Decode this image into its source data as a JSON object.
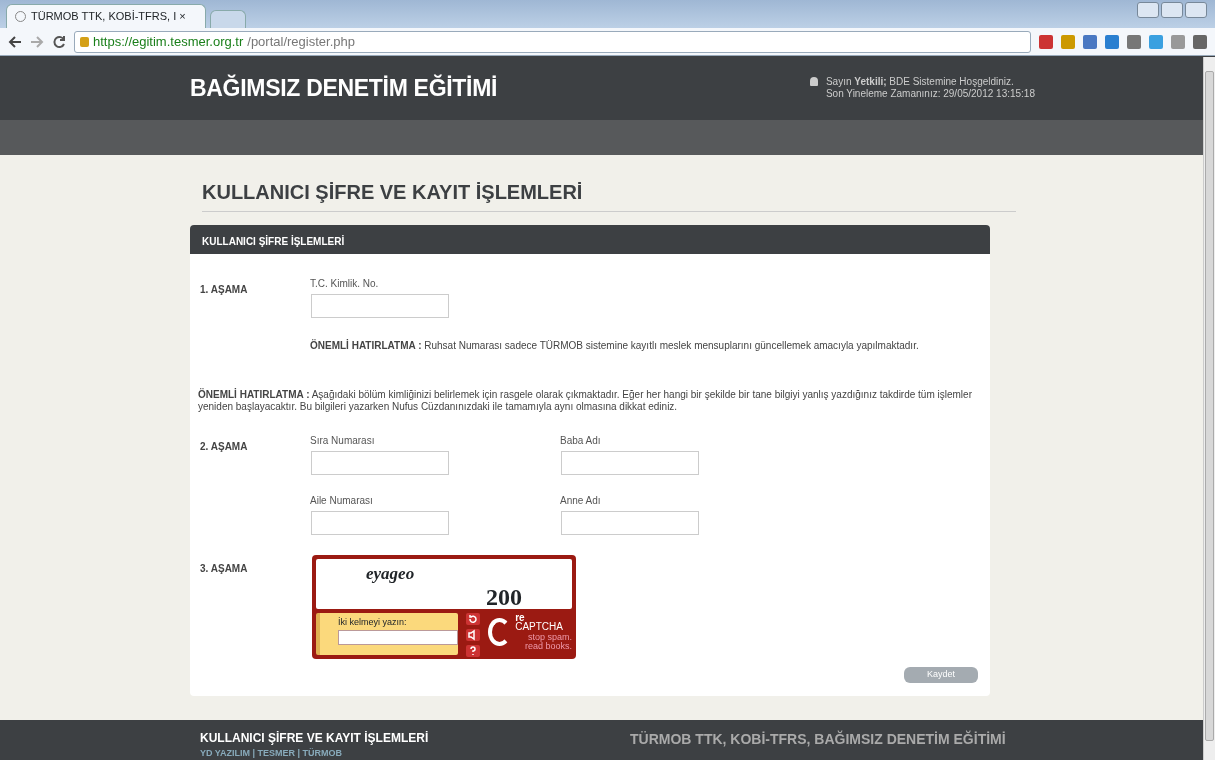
{
  "browser": {
    "tab_title": "TÜRMOB TTK, KOBİ-TFRS, I ×",
    "url_host": "https://egitim.tesmer.org.tr",
    "url_path": "/portal/register.php"
  },
  "header": {
    "title": "BAĞIMSIZ DENETİM EĞİTİMİ",
    "greeting": "Sayın **Yetkili;** BDE Sistemine Hoşgeldiniz.",
    "last_refresh": "Son Yineleme Zamanınız: 29/05/2012 13:15:18"
  },
  "page_title": "KULLANICI ŞİFRE VE KAYIT İŞLEMLERİ",
  "panel": {
    "title": "KULLANICI ŞİFRE İŞLEMLERİ",
    "step1": {
      "label": "1. AŞAMA",
      "fields": [
        {
          "label": "T.C. Kimlik. No."
        }
      ],
      "note": "**ÖNEMLİ HATIRLATMA :** Ruhsat Numarası sadece TÜRMOB sistemine kayıtlı meslek mensuplarını güncellemek amacıyla yapılmaktadır."
    },
    "note": "**ÖNEMLİ HATIRLATMA :** Aşağıdaki bölüm kimliğinizi belirlemek için rasgele olarak çıkmaktadır. Eğer her hangi bir şekilde bir tane bilgiyi yanlış yazdığınız takdirde tüm işlemler yeniden başlayacaktır. Bu bilgileri yazarken Nufus Cüzdanınızdaki ile tamamıyla aynı olmasına dikkat ediniz.",
    "step2": {
      "label": "2. AŞAMA",
      "fields": [
        {
          "label": "Sıra Numarası"
        },
        {
          "label": "Baba Adı"
        },
        {
          "label": "Aile Numarası"
        },
        {
          "label": "Anne Adı"
        }
      ]
    },
    "step3": {
      "label": "3. AŞAMA",
      "captcha": {
        "word1": "eyageo",
        "word2": "200",
        "prompt": "İki kelmeyi yazın:",
        "brand": "CAPTCHA",
        "brand_prefix": "re",
        "tagline1": "stop spam.",
        "tagline2": "read books."
      }
    },
    "submit": "Kaydet"
  },
  "footer": {
    "title": "KULLANICI ŞİFRE VE KAYIT İŞLEMLERİ",
    "links": "YD YAZILIM | TESMER | TÜRMOB",
    "right": "TÜRMOB TTK, KOBİ-TFRS, BAĞIMSIZ DENETİM EĞİTİMİ"
  }
}
